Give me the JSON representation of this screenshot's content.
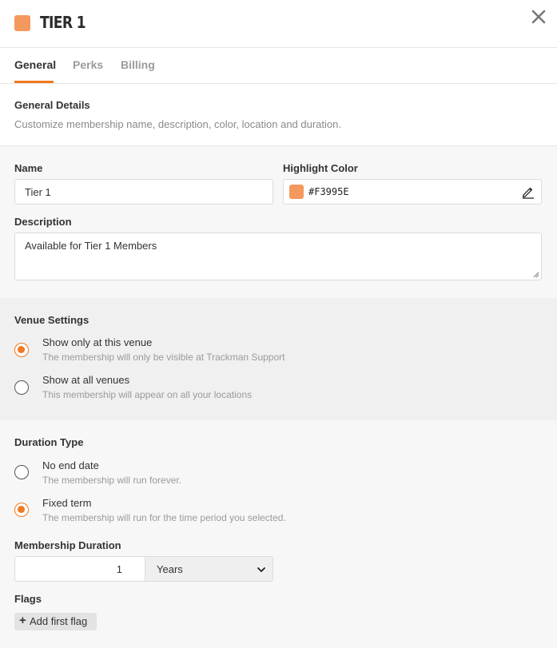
{
  "header": {
    "title": "TIER 1",
    "swatch_color": "#F3995E",
    "close_icon": "close-icon"
  },
  "tabs": [
    {
      "label": "General",
      "active": true
    },
    {
      "label": "Perks",
      "active": false
    },
    {
      "label": "Billing",
      "active": false
    }
  ],
  "accent_color": "#F07A20",
  "general_details": {
    "heading": "General Details",
    "subtitle": "Customize membership name, description, color, location and duration."
  },
  "form": {
    "name_label": "Name",
    "name_value": "Tier 1",
    "highlight_label": "Highlight Color",
    "highlight_value": "#F3995E",
    "description_label": "Description",
    "description_value": "Available for Tier 1 Members"
  },
  "venue_settings": {
    "heading": "Venue Settings",
    "options": [
      {
        "title": "Show only at this venue",
        "subtitle": "The membership will only be visible at Trackman Support",
        "selected": true
      },
      {
        "title": "Show at all venues",
        "subtitle": "This membership will appear on all your locations",
        "selected": false
      }
    ]
  },
  "duration_type": {
    "heading": "Duration Type",
    "options": [
      {
        "title": "No end date",
        "subtitle": "The membership will run forever.",
        "selected": false
      },
      {
        "title": "Fixed term",
        "subtitle": "The membership will run for the time period you selected.",
        "selected": true
      }
    ]
  },
  "membership_duration": {
    "label": "Membership Duration",
    "amount": "1",
    "unit": "Years"
  },
  "flags": {
    "label": "Flags",
    "add_button": "Add first flag"
  }
}
